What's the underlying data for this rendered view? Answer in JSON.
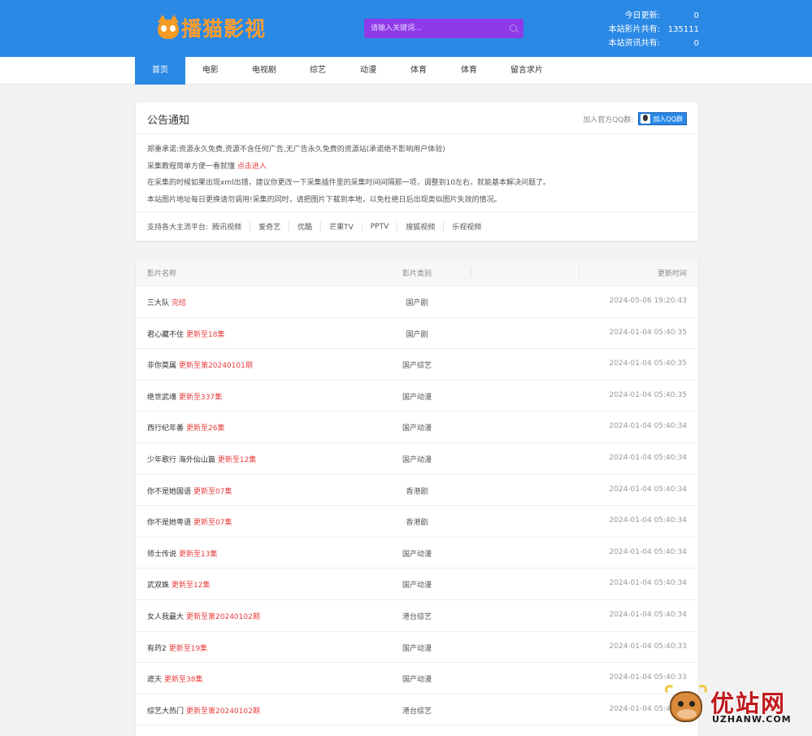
{
  "header": {
    "logo_text": "播猫影视",
    "search_placeholder": "请输入关键词...",
    "stats": [
      {
        "label": "今日更新:",
        "value": "0"
      },
      {
        "label": "本站影片共有:",
        "value": "135111"
      },
      {
        "label": "本站资讯共有:",
        "value": "0"
      }
    ]
  },
  "nav": {
    "items": [
      {
        "label": "首页",
        "active": true
      },
      {
        "label": "电影"
      },
      {
        "label": "电视剧"
      },
      {
        "label": "综艺"
      },
      {
        "label": "动漫"
      },
      {
        "label": "体育"
      },
      {
        "label": "体育"
      },
      {
        "label": "留言求片"
      }
    ]
  },
  "notice": {
    "title": "公告通知",
    "qq_label": "加入官方QQ群:",
    "qq_button": "加入QQ群",
    "line1": "郑重承诺:资源永久免费,资源不含任何广告,无广告永久免费的资源站(承诺绝不影响用户体验)",
    "line2_text": "采集教程简单方便一看就懂",
    "line2_link": "点击进入",
    "line3": "在采集的时候如果出现xml出错，建议你更改一下采集插件里的采集时间间隔那一项，调整到10左右，就能基本解决问题了。",
    "line4": "本站图片地址每日更换请勿调用!采集的同时，请把图片下载到本地，以免杜绝日后出现类似图片失效的情况。",
    "platforms_label": "支持各大主流平台:",
    "platforms": [
      "腾讯视频",
      "爱奇艺",
      "优酷",
      "芒果TV",
      "PPTV",
      "搜狐视频",
      "乐视视频"
    ]
  },
  "table": {
    "headers": {
      "name": "影片名称",
      "category": "影片类别",
      "time": "更新时间"
    },
    "rows": [
      {
        "name": "三大队",
        "update": "完结",
        "category": "国产剧",
        "time": "2024-05-06 19:20:43"
      },
      {
        "name": "君心藏不住",
        "update": "更新至18集",
        "category": "国产剧",
        "time": "2024-01-04 05:40:35"
      },
      {
        "name": "非你莫属",
        "update": "更新至第20240101期",
        "category": "国产综艺",
        "time": "2024-01-04 05:40:35"
      },
      {
        "name": "绝世武魂",
        "update": "更新至337集",
        "category": "国产动漫",
        "time": "2024-01-04 05:40:35"
      },
      {
        "name": "西行纪年番",
        "update": "更新至26集",
        "category": "国产动漫",
        "time": "2024-01-04 05:40:34"
      },
      {
        "name": "少年歌行 海外仙山篇",
        "update": "更新至12集",
        "category": "国产动漫",
        "time": "2024-01-04 05:40:34"
      },
      {
        "name": "你不是她国语",
        "update": "更新至07集",
        "category": "香港剧",
        "time": "2024-01-04 05:40:34"
      },
      {
        "name": "你不是她粤语",
        "update": "更新至07集",
        "category": "香港剧",
        "time": "2024-01-04 05:40:34"
      },
      {
        "name": "师士传说",
        "update": "更新至13集",
        "category": "国产动漫",
        "time": "2024-01-04 05:40:34"
      },
      {
        "name": "武双姝",
        "update": "更新至12集",
        "category": "国产动漫",
        "time": "2024-01-04 05:40:34"
      },
      {
        "name": "女人我最大",
        "update": "更新至第20240102期",
        "category": "港台综艺",
        "time": "2024-01-04 05:40:34"
      },
      {
        "name": "有药2",
        "update": "更新至19集",
        "category": "国产动漫",
        "time": "2024-01-04 05:40:33"
      },
      {
        "name": "遮天",
        "update": "更新至38集",
        "category": "国产动漫",
        "time": "2024-01-04 05:40:33"
      },
      {
        "name": "综艺大热门",
        "update": "更新至第20240102期",
        "category": "港台综艺",
        "time": "2024-01-04 05:40:33"
      }
    ]
  },
  "watermark": {
    "zh": "优站网",
    "en": "UZHANW.COM"
  },
  "colors": {
    "header_bg": "#2b89e6",
    "search_bg": "#8e3ae8",
    "update_red": "#e83e3e",
    "logo_orange": "#ff9d2e"
  }
}
